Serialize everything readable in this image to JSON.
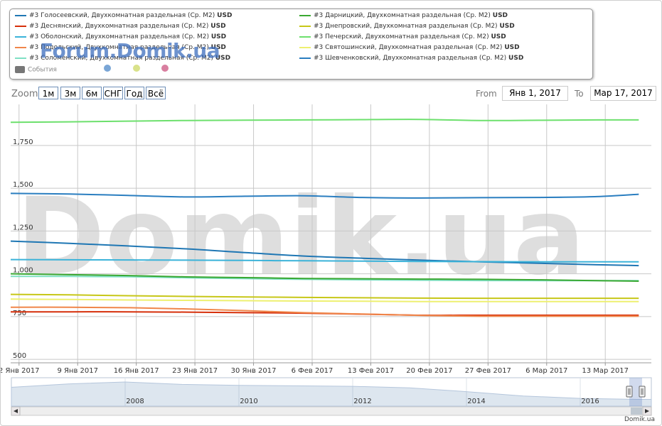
{
  "watermark": {
    "big": "Domik.ua",
    "forum": "Forum.Domik.ua",
    "small": "Domik.ua"
  },
  "legend": {
    "events_label": "События",
    "event_dot_colors": [
      "#7aa6d6",
      "#d9e28a",
      "#d97fa0"
    ]
  },
  "zoom": {
    "label": "Zoom",
    "buttons": [
      "1м",
      "3м",
      "6м",
      "СНГ",
      "Год",
      "Всё"
    ]
  },
  "range": {
    "from_label": "From",
    "from_value": "Янв 1, 2017",
    "to_label": "To",
    "to_value": "Мар 17, 2017"
  },
  "chart_data": {
    "type": "line",
    "x": [
      "2017-01-01",
      "2017-01-08",
      "2017-01-15",
      "2017-01-22",
      "2017-01-29",
      "2017-02-05",
      "2017-02-12",
      "2017-02-19",
      "2017-02-26",
      "2017-03-05",
      "2017-03-12",
      "2017-03-17"
    ],
    "x_tick_labels": [
      "2 Янв 2017",
      "9 Янв 2017",
      "16 Янв 2017",
      "23 Янв 2017",
      "30 Янв 2017",
      "6 Фев 2017",
      "13 Фев 2017",
      "20 Фев 2017",
      "27 Фев 2017",
      "6 Мар 2017",
      "13 Мар 2017"
    ],
    "x_tick_dates": [
      "2017-01-02",
      "2017-01-09",
      "2017-01-16",
      "2017-01-23",
      "2017-01-30",
      "2017-02-06",
      "2017-02-13",
      "2017-02-20",
      "2017-02-27",
      "2017-03-06",
      "2017-03-13"
    ],
    "y_ticks": [
      500,
      750,
      1000,
      1250,
      1500,
      1750
    ],
    "y_tick_labels": [
      "500",
      "750",
      "1,000",
      "1,250",
      "1,500",
      "1,750"
    ],
    "ylim": [
      480,
      1990
    ],
    "grid": true,
    "legend_position": "top",
    "series": [
      {
        "name": "#3 Голосеевский, Двухкомнатная раздельная (Ср. М2)",
        "unit": "USD",
        "color": "#1f77b4",
        "values": [
          1191,
          1178,
          1163,
          1146,
          1124,
          1104,
          1091,
          1080,
          1070,
          1062,
          1053,
          1048
        ]
      },
      {
        "name": "#3 Деснянский, Двухкомнатная раздельная (Ср. М2)",
        "unit": "USD",
        "color": "#d62f0a",
        "values": [
          778,
          778,
          778,
          776,
          773,
          770,
          764,
          758,
          758,
          758,
          758,
          758
        ]
      },
      {
        "name": "#3 Оболонский, Двухкомнатная раздельная (Ср. М2)",
        "unit": "USD",
        "color": "#3bb3d9",
        "values": [
          1083,
          1082,
          1081,
          1080,
          1078,
          1076,
          1074,
          1072,
          1071,
          1070,
          1070,
          1070
        ]
      },
      {
        "name": "#3 Подольский, Двухкомнатная раздельная (Ср. М2)",
        "unit": "USD",
        "color": "#f0864a",
        "values": [
          805,
          805,
          802,
          795,
          785,
          773,
          765,
          757,
          752,
          752,
          752,
          752
        ]
      },
      {
        "name": "#3 Соломенский, Двухкомнатная раздельная (Ср. М2)",
        "unit": "USD",
        "color": "#7fe0c4",
        "values": [
          985,
          985,
          983,
          977,
          972,
          968,
          965,
          963,
          961,
          960,
          960,
          960
        ]
      },
      {
        "name": "#3 Дарницкий, Двухкомнатная раздельная (Ср. М2)",
        "unit": "USD",
        "color": "#3aa832",
        "values": [
          1000,
          995,
          990,
          982,
          978,
          973,
          971,
          969,
          968,
          965,
          960,
          957
        ]
      },
      {
        "name": "#3 Днепровский, Двухкомнатная раздельная (Ср. М2)",
        "unit": "USD",
        "color": "#c7c718",
        "values": [
          880,
          877,
          872,
          868,
          865,
          862,
          860,
          858,
          857,
          857,
          857,
          857
        ]
      },
      {
        "name": "#3 Печерский, Двухкомнатная раздельная (Ср. М2)",
        "unit": "USD",
        "color": "#6de06d",
        "values": [
          1885,
          1888,
          1892,
          1896,
          1898,
          1899,
          1901,
          1902,
          1896,
          1897,
          1899,
          1899
        ]
      },
      {
        "name": "#3 Святошинский, Двухкомнатная раздельная (Ср. М2)",
        "unit": "USD",
        "color": "#eef070",
        "values": [
          852,
          850,
          847,
          845,
          843,
          841,
          840,
          838,
          838,
          838,
          838,
          838
        ]
      },
      {
        "name": "#3 Шевченковский, Двухкомнатная раздельная (Ср. М2)",
        "unit": "USD",
        "color": "#2a7ec0",
        "values": [
          1470,
          1466,
          1458,
          1449,
          1453,
          1456,
          1446,
          1443,
          1445,
          1446,
          1451,
          1465
        ]
      }
    ],
    "navigator": {
      "x_labels": [
        "2008",
        "2010",
        "2012",
        "2014",
        "2016"
      ],
      "x_years": [
        2008,
        2010,
        2012,
        2014,
        2016
      ],
      "years": [
        2006,
        2007,
        2008,
        2009,
        2010,
        2011,
        2012,
        2013,
        2014,
        2015,
        2016,
        2017
      ],
      "values": [
        0.78,
        0.92,
        1.0,
        0.9,
        0.86,
        0.84,
        0.82,
        0.76,
        0.6,
        0.42,
        0.32,
        0.28
      ]
    }
  }
}
